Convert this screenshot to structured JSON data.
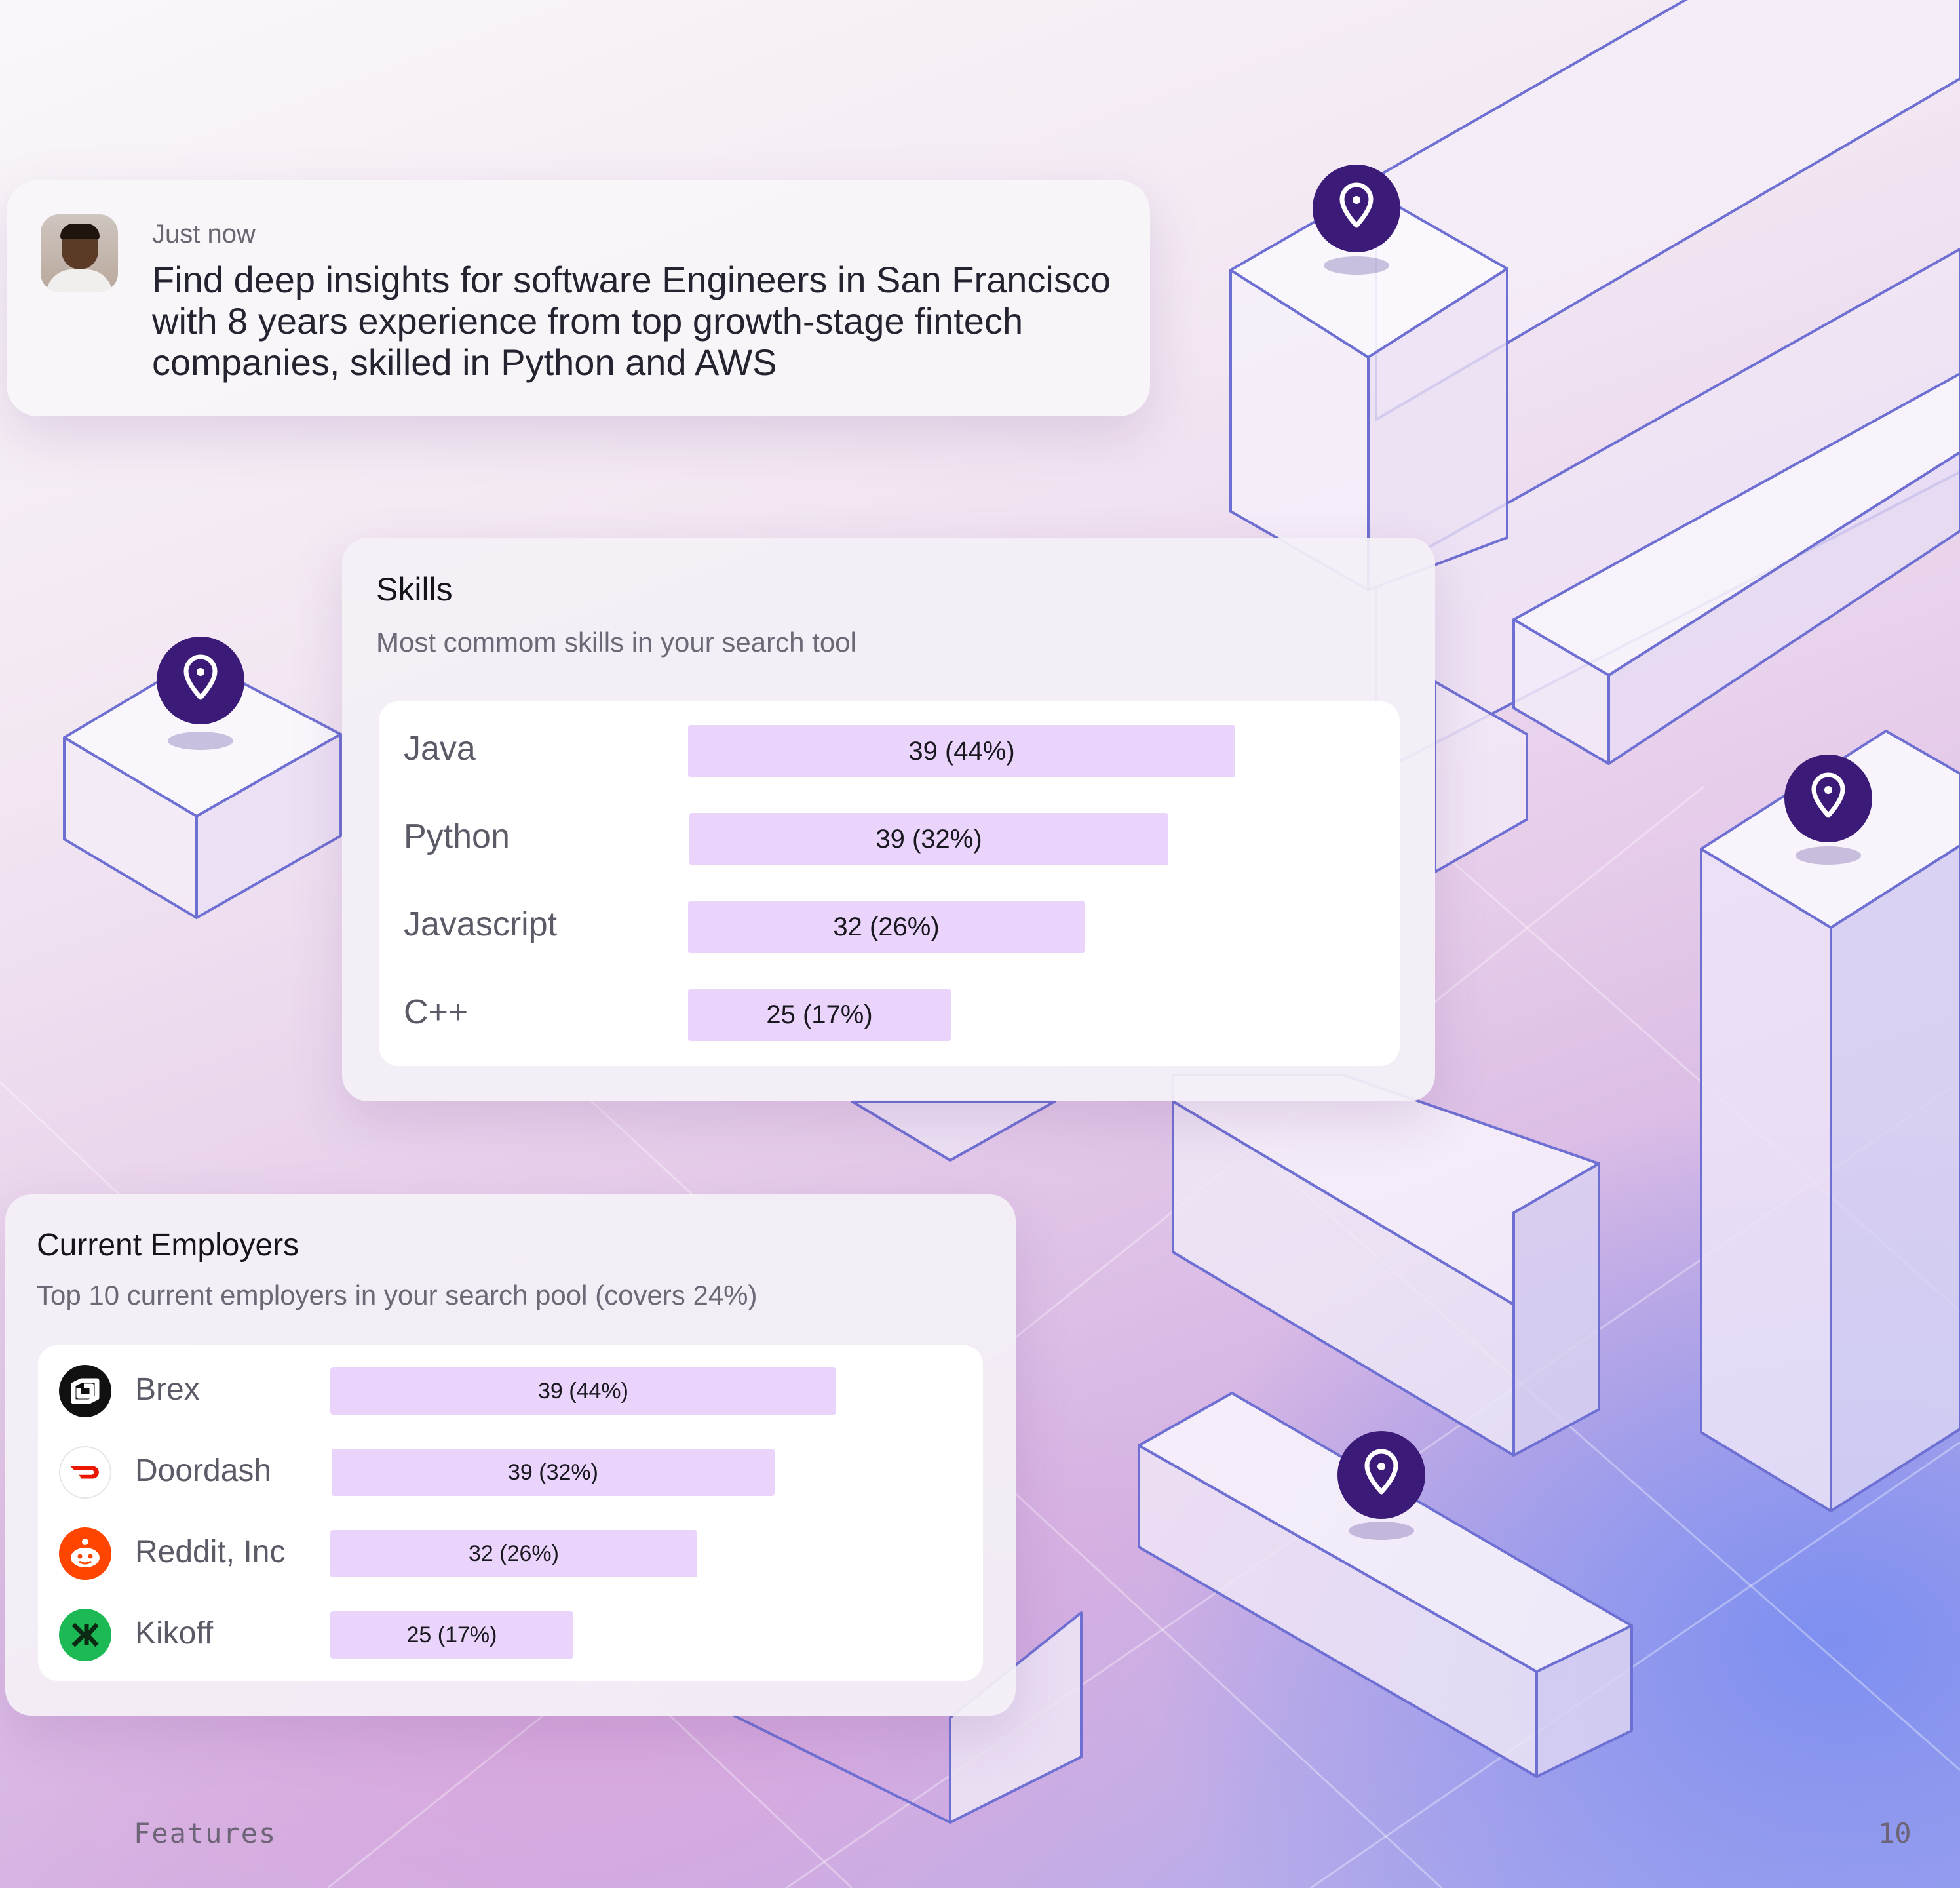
{
  "prompt": {
    "time": "Just now",
    "text": "Find deep insights for software Engineers in San Francisco with 8 years experience from top growth-stage fintech companies, skilled in Python and AWS"
  },
  "skills": {
    "title": "Skills",
    "subtitle": "Most commom skills in your search tool",
    "chart_data": {
      "type": "bar",
      "categories": [
        "Java",
        "Python",
        "Javascript",
        "C++"
      ],
      "values": [
        39,
        39,
        32,
        25
      ],
      "value_labels": [
        "39 (44%)",
        "39 (32%)",
        "32 (26%)",
        "25 (17%)"
      ],
      "fill_fraction": [
        1.0,
        0.875,
        0.725,
        0.48
      ]
    }
  },
  "employers": {
    "title": "Current Employers",
    "subtitle": "Top 10 current employers in your search pool (covers 24%)",
    "chart_data": {
      "type": "bar",
      "categories": [
        "Brex",
        "Doordash",
        "Reddit, Inc",
        "Kikoff"
      ],
      "values": [
        39,
        39,
        32,
        25
      ],
      "value_labels": [
        "39 (44%)",
        "39 (32%)",
        "32 (26%)",
        "25 (17%)"
      ],
      "fill_fraction": [
        1.0,
        0.875,
        0.725,
        0.48
      ]
    },
    "logos": [
      {
        "name": "brex-logo-icon",
        "color": "#111111"
      },
      {
        "name": "doordash-logo-icon",
        "color": "#eb1700"
      },
      {
        "name": "reddit-logo-icon",
        "color": "#ff4500"
      },
      {
        "name": "kikoff-logo-icon",
        "color": "#1db954"
      }
    ]
  },
  "footer": {
    "section": "Features",
    "page": "10"
  },
  "colors": {
    "pin": "#3b1a78",
    "bar_fill": "#ead4fb",
    "outline": "#6f6fd0"
  }
}
